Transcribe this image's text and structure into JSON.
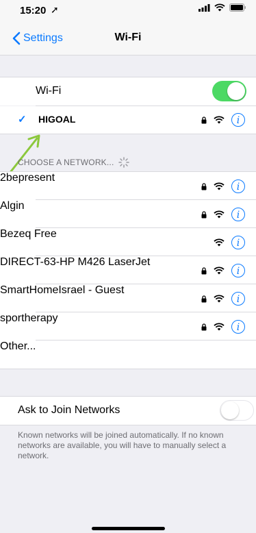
{
  "status": {
    "time": "15:20",
    "location_icon": "location-arrow-icon"
  },
  "nav": {
    "back_label": "Settings",
    "title": "Wi-Fi"
  },
  "wifi": {
    "label": "Wi-Fi",
    "enabled": true
  },
  "connected": {
    "name": "HIGOAL",
    "locked": true
  },
  "section_header": "CHOOSE A NETWORK...",
  "networks": [
    {
      "name": "2bepresent",
      "locked": true
    },
    {
      "name": "Algin",
      "locked": true
    },
    {
      "name": "Bezeq Free",
      "locked": false
    },
    {
      "name": "DIRECT-63-HP M426 LaserJet",
      "locked": true
    },
    {
      "name": "SmartHomeIsrael - Guest",
      "locked": true
    },
    {
      "name": "sportherapy",
      "locked": true
    }
  ],
  "other_label": "Other...",
  "ask": {
    "label": "Ask to Join Networks",
    "enabled": false
  },
  "footer_text": "Known networks will be joined automatically. If no known networks are available, you will have to manually select a network.",
  "colors": {
    "accent": "#0a7aff",
    "switch_on": "#4cd964",
    "annotation_arrow": "#8cc83c"
  }
}
